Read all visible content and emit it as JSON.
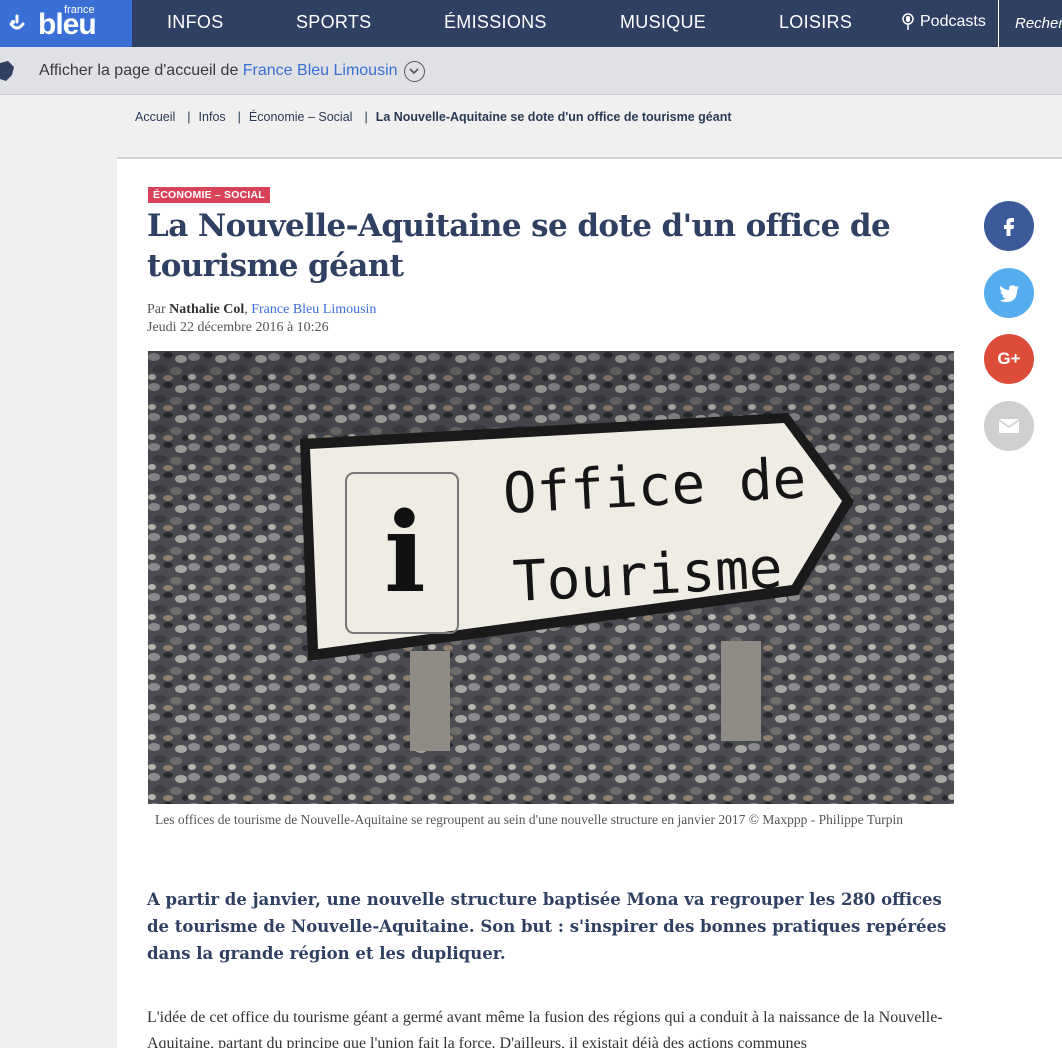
{
  "brand": {
    "small": "france",
    "big": "bleu"
  },
  "nav": {
    "items": [
      "INFOS",
      "SPORTS",
      "ÉMISSIONS",
      "MUSIQUE",
      "LOISIRS"
    ],
    "podcasts": "Podcasts",
    "search": "Recher"
  },
  "local_bar": {
    "prefix": "Afficher la page d'accueil de ",
    "station": "France Bleu Limousin"
  },
  "breadcrumb": [
    "Accueil",
    "Infos",
    "Économie – Social",
    "La Nouvelle-Aquitaine se dote d'un office de tourisme géant"
  ],
  "article": {
    "category": "ÉCONOMIE – SOCIAL",
    "title": "La Nouvelle-Aquitaine se dote d'un office de tourisme géant",
    "by": "Par ",
    "author": "Nathalie Col",
    "author_sep": ", ",
    "station": "France Bleu Limousin",
    "date": "Jeudi 22 décembre 2016 à 10:26",
    "photo": {
      "sign_line1": "Office de",
      "sign_line2": "Tourisme",
      "sign_icon": "i"
    },
    "caption": "Les offices de tourisme de Nouvelle-Aquitaine se regroupent au sein d'une nouvelle structure en janvier 2017 © Maxppp - Philippe Turpin",
    "lead": "A partir de janvier, une nouvelle structure baptisée Mona va regrouper les 280 offices de tourisme de Nouvelle-Aquitaine. Son but : s'inspirer des bonnes pratiques repérées dans la grande région et les dupliquer.",
    "body": "L'idée de cet office du tourisme géant a germé avant même la fusion des régions qui a conduit à la naissance de la Nouvelle-Aquitaine, partant du principe que l'union fait la force. D'ailleurs, il existait déjà des actions communes"
  },
  "share": {
    "gplus": "G+"
  },
  "colors": {
    "nav_bg": "#2f4063",
    "logo_bg": "#3a6fd6",
    "category_bg": "#d9435a",
    "facebook": "#3b5a9a",
    "twitter": "#55acee",
    "gplus": "#dd4b39",
    "mail": "#cfcfcf"
  }
}
